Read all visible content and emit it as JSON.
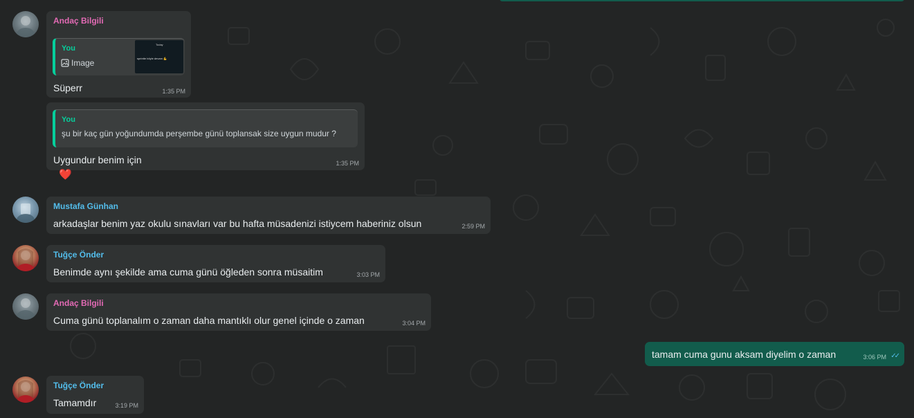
{
  "messages": [
    {
      "sender": "Andaç Bilgili",
      "quote": {
        "author": "You",
        "label": "Image",
        "thumb_date": "Today",
        "thumb_text": "sprintte böyle devam 💪"
      },
      "text": "Süperr",
      "time": "1:35 PM"
    },
    {
      "quote": {
        "author": "You",
        "text": "şu bir kaç gün yoğundumda perşembe günü toplansak size uygun mudur ?"
      },
      "text": "Uygundur benim için",
      "time": "1:35 PM",
      "reaction": "❤️"
    },
    {
      "sender": "Mustafa Günhan",
      "text": "arkadaşlar benim yaz okulu sınavları var  bu hafta müsadenizi istiycem haberiniz olsun",
      "time": "2:59 PM"
    },
    {
      "sender": "Tuğçe Önder",
      "text": "Benimde aynı şekilde ama cuma günü öğleden sonra müsaitim",
      "time": "3:03 PM"
    },
    {
      "sender": "Andaç Bilgili",
      "text": "Cuma günü toplanalım o zaman daha mantıklı olur genel içinde o zaman",
      "time": "3:04 PM"
    },
    {
      "outgoing": true,
      "text": "tamam cuma gunu aksam diyelim o zaman",
      "time": "3:06 PM",
      "status": "read"
    },
    {
      "sender": "Tuğçe Önder",
      "text": "Tamamdır",
      "time": "3:19 PM"
    }
  ],
  "colors": {
    "background": "#232525",
    "incoming_bubble": "#303333",
    "outgoing_bubble": "#125c4c",
    "sender_pink": "#e26ab4",
    "sender_blue": "#53bdeb",
    "quote_accent": "#06cf9c",
    "read_ticks": "#53bdeb"
  }
}
